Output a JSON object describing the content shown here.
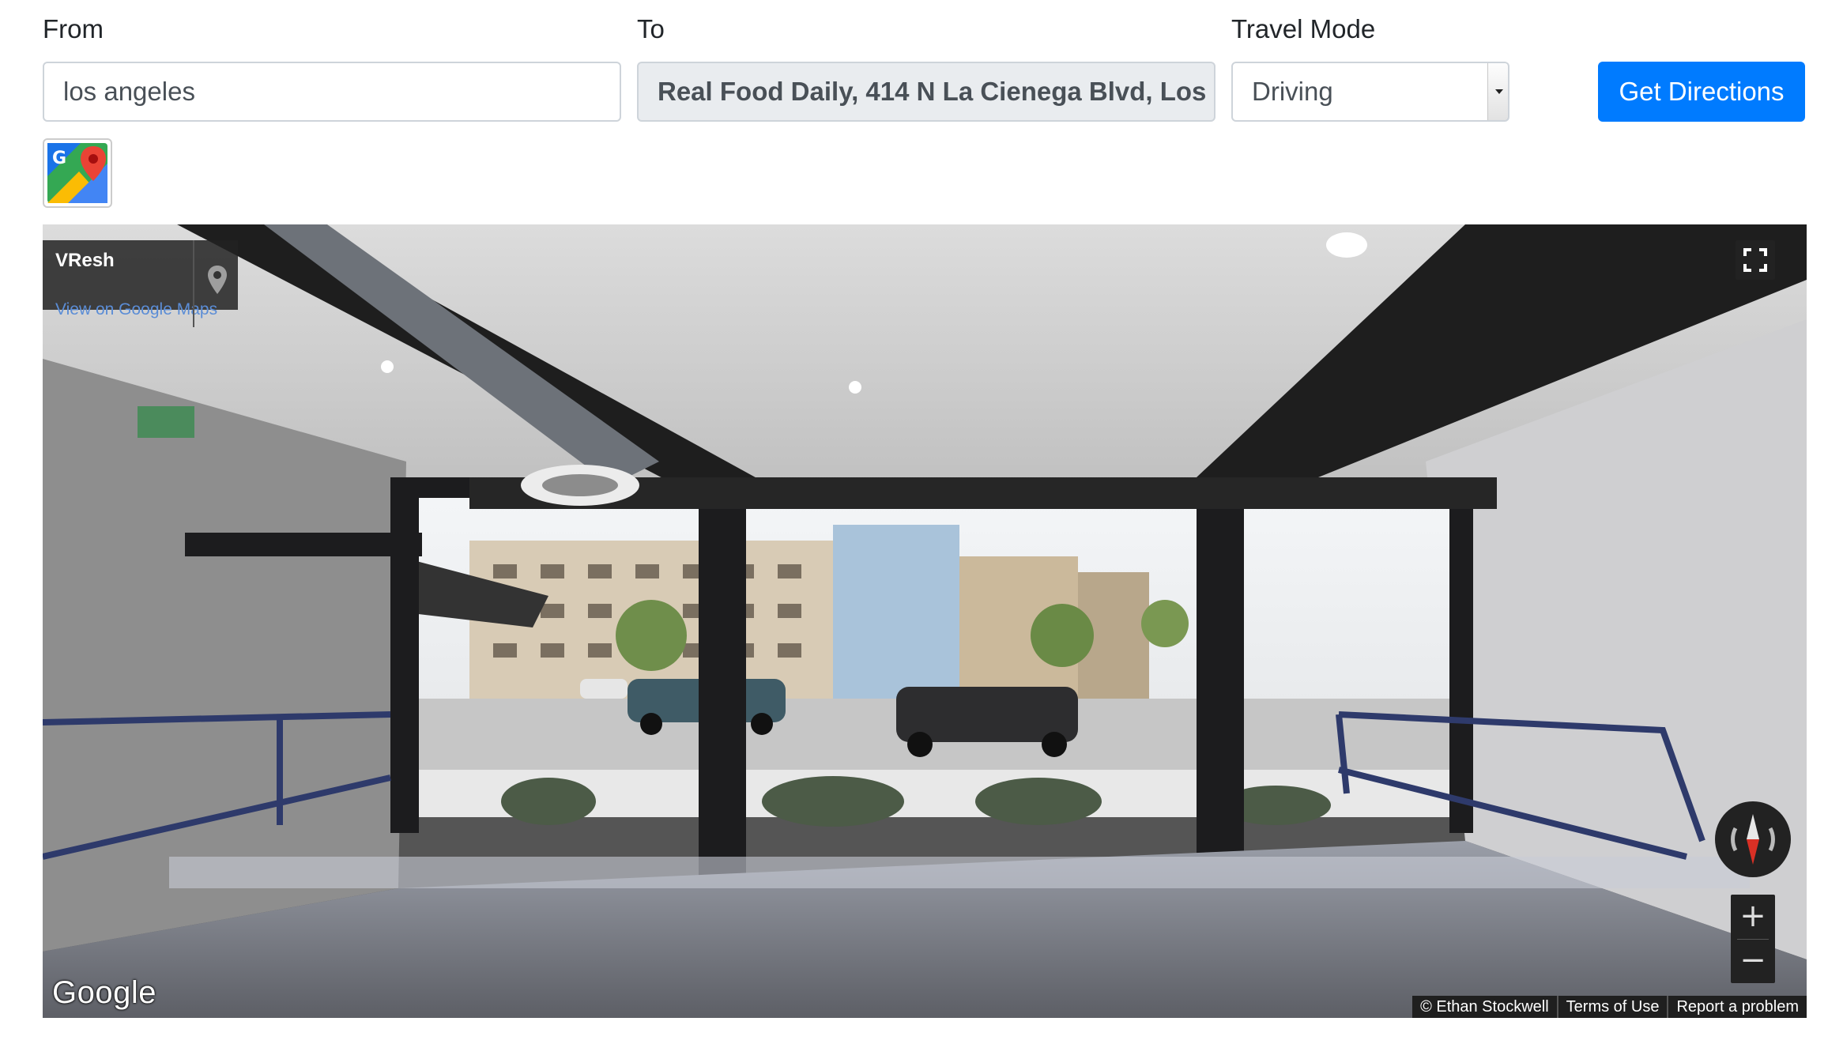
{
  "form": {
    "from_label": "From",
    "from_value": "los angeles",
    "to_label": "To",
    "to_value": "Real Food Daily, 414 N La Cienega Blvd, Los",
    "mode_label": "Travel Mode",
    "mode_value": "Driving",
    "submit_label": "Get Directions",
    "maps_icon": "google-maps-icon"
  },
  "streetview": {
    "place_name": "VResh",
    "view_link": "View on Google Maps",
    "logo": "Google",
    "attribution": [
      "© Ethan Stockwell",
      "Terms of Use",
      "Report a problem"
    ],
    "zoom_in": "+",
    "zoom_out": "−",
    "icons": [
      "map-pin-icon",
      "fullscreen-icon",
      "compass-icon"
    ]
  },
  "colors": {
    "accent": "#007bff",
    "panel_dark": "#222222",
    "link": "#5b8dd6"
  }
}
